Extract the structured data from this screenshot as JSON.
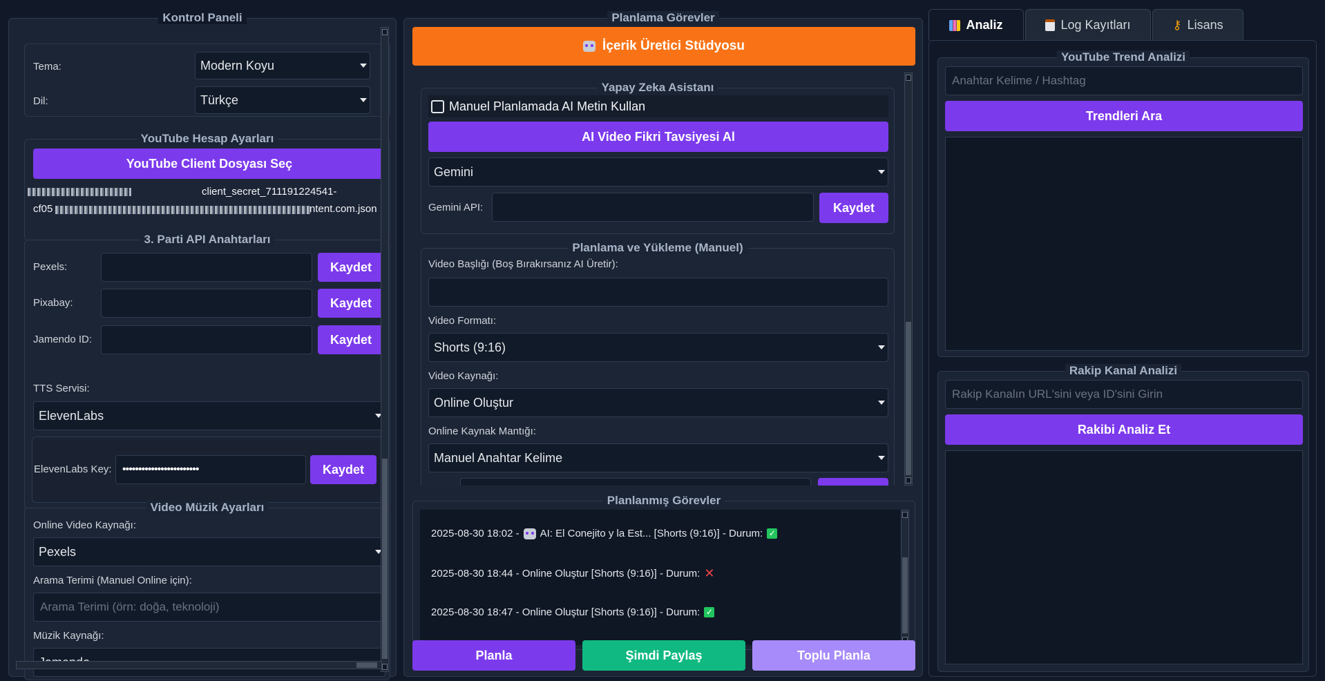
{
  "left": {
    "title": "Kontrol Paneli",
    "theme_label": "Tema:",
    "theme_value": "Modern Koyu",
    "lang_label": "Dil:",
    "lang_value": "Türkçe",
    "yt_title": "YouTube Hesap Ayarları",
    "yt_button": "YouTube Client Dosyası Seç",
    "yt_file_line1": "client_secret_711191224541-",
    "yt_file_line2": "cf05",
    "yt_file_line2_end": "ntent.com.json",
    "api_title": "3. Parti API Anahtarları",
    "pexels_label": "Pexels:",
    "pixabay_label": "Pixabay:",
    "jamendo_label": "Jamendo ID:",
    "save": "Kaydet",
    "tts_label": "TTS Servisi:",
    "tts_value": "ElevenLabs",
    "eleven_label": "ElevenLabs Key:",
    "eleven_value": "••••••••••••••••••••••••",
    "vm_title": "Video  Müzik Ayarları",
    "online_src_label": "Online Video Kaynağı:",
    "online_src_value": "Pexels",
    "search_label": "Arama Terimi (Manuel Online için):",
    "search_placeholder": "Arama Terimi (örn: doğa, teknoloji)",
    "music_label": "Müzik Kaynağı:",
    "music_value": "Jamendo"
  },
  "middle": {
    "title": "Planlama  Görevler",
    "studio_button": "İçerik Üretici Stüdyosu",
    "ai_title": "Yapay Zeka Asistanı",
    "ai_checkbox": "Manuel Planlamada AI Metin Kullan",
    "ai_button": "AI Video Fikri Tavsiyesi Al",
    "model_value": "Gemini",
    "gemini_label": "Gemini API:",
    "save": "Kaydet",
    "plan_title": "Planlama ve Yükleme (Manuel)",
    "video_title_label": "Video Başlığı (Boş Bırakırsanız AI Üretir):",
    "format_label": "Video Formatı:",
    "format_value": "Shorts (9:16)",
    "source_label": "Video Kaynağı:",
    "source_value": "Online Oluştur",
    "logic_label": "Online Kaynak Mantığı:",
    "logic_value": "Manuel Anahtar Kelime",
    "tasks_title": "Planlanmış Görevler",
    "tasks": [
      {
        "text": "2025-08-30 18:02 - ",
        "ai": "AI: El Conejito y la Est... [Shorts (9:16)] - Durum: ",
        "status": "✓"
      },
      {
        "text": "2025-08-30 18:44 - Online Oluştur [Shorts (9:16)] - Durum: ",
        "status": "✕"
      },
      {
        "text": "2025-08-30 18:47 - Online Oluştur [Shorts (9:16)] - Durum: ",
        "status": "✓"
      }
    ],
    "btn_plan": "Planla",
    "btn_share": "Şimdi Paylaş",
    "btn_bulk": "Toplu Planla"
  },
  "right": {
    "tabs": [
      "Analiz",
      "Log Kayıtları",
      "Lisans"
    ],
    "trend_title": "YouTube Trend Analizi",
    "trend_placeholder": "Anahtar Kelime / Hashtag",
    "trend_button": "Trendleri Ara",
    "rival_title": "Rakip Kanal Analizi",
    "rival_placeholder": "Rakip Kanalın URL'sini veya ID'sini Girin",
    "rival_button": "Rakibi Analiz Et"
  },
  "colors": {
    "accent": "#7c3aed",
    "orange": "#f97316",
    "green": "#10b981",
    "light_purple": "#a78bfa"
  }
}
